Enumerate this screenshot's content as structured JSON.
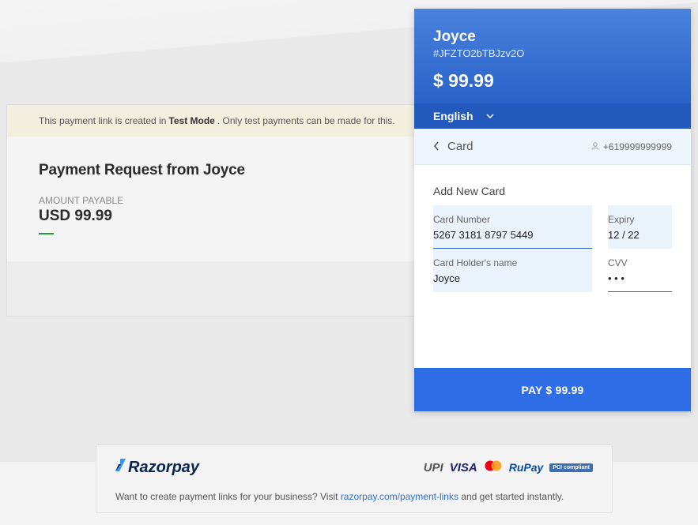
{
  "banner": {
    "text_before": "This payment link is created in",
    "mode": "Test Mode",
    "text_after": ". Only test payments can be made for this."
  },
  "request": {
    "title": "Payment Request from Joyce",
    "amount_label": "AMOUNT PAYABLE",
    "amount_value": "USD 99.99"
  },
  "checkout": {
    "merchant_name": "Joyce",
    "order_id": "#JFZTO2bTBJzv2O",
    "amount": "$ 99.99",
    "language": "English",
    "method_title": "Card",
    "contact": "+619999999999",
    "add_card_label": "Add New Card",
    "card_number": {
      "label": "Card Number",
      "value": "5267 3181 8797 5449"
    },
    "expiry": {
      "label": "Expiry",
      "value": "12 / 22"
    },
    "holder": {
      "label": "Card Holder's name",
      "value": "Joyce"
    },
    "cvv": {
      "label": "CVV",
      "value": "• • •"
    },
    "pay_label": "PAY $ 99.99"
  },
  "footer": {
    "brand": "Razorpay",
    "badges": [
      "UPI",
      "VISA",
      "RuPay",
      "PCI compliant"
    ],
    "text_before": "Want to create payment links for your business? Visit",
    "link_text": "razorpay.com/payment-links",
    "text_after": "and get started instantly."
  },
  "colors": {
    "primary": "#2d6ee6",
    "header_top": "#4a82de",
    "header_bottom": "#2a61c8",
    "accent_green": "#1e9c46"
  }
}
